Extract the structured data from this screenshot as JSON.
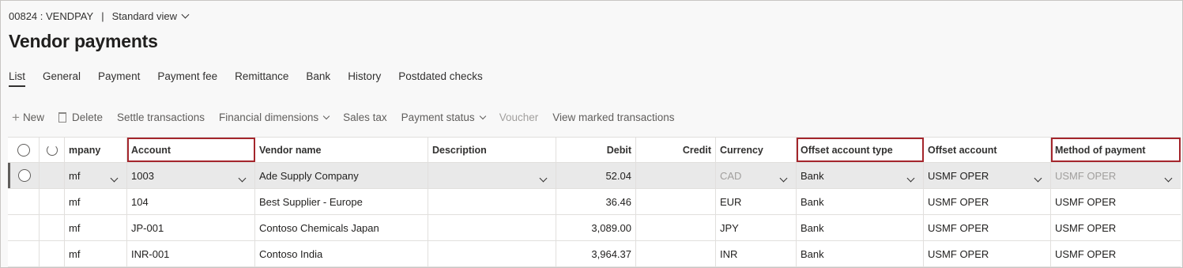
{
  "breadcrumb": {
    "record": "00824 : VENDPAY",
    "separator": "|",
    "view": "Standard view"
  },
  "page_title": "Vendor payments",
  "tabs": [
    "List",
    "General",
    "Payment",
    "Payment fee",
    "Remittance",
    "Bank",
    "History",
    "Postdated checks"
  ],
  "toolbar": {
    "new": "New",
    "delete": "Delete",
    "settle": "Settle transactions",
    "financial_dimensions": "Financial dimensions",
    "sales_tax": "Sales tax",
    "payment_status": "Payment status",
    "voucher": "Voucher",
    "view_marked": "View marked transactions"
  },
  "columns": {
    "company": "mpany",
    "account": "Account",
    "vendor_name": "Vendor name",
    "description": "Description",
    "debit": "Debit",
    "credit": "Credit",
    "currency": "Currency",
    "offset_account_type": "Offset account type",
    "offset_account": "Offset account",
    "method_of_payment": "Method of payment"
  },
  "rows": [
    {
      "company": "mf",
      "account": "1003",
      "vendor_name": "Ade Supply Company",
      "description": "",
      "debit": "52.04",
      "credit": "",
      "currency": "CAD",
      "offset_account_type": "Bank",
      "offset_account": "USMF OPER",
      "method_of_payment": "USMF OPER"
    },
    {
      "company": "mf",
      "account": "104",
      "vendor_name": "Best Supplier - Europe",
      "description": "",
      "debit": "36.46",
      "credit": "",
      "currency": "EUR",
      "offset_account_type": "Bank",
      "offset_account": "USMF OPER",
      "method_of_payment": "USMF OPER"
    },
    {
      "company": "mf",
      "account": "JP-001",
      "vendor_name": "Contoso Chemicals Japan",
      "description": "",
      "debit": "3,089.00",
      "credit": "",
      "currency": "JPY",
      "offset_account_type": "Bank",
      "offset_account": "USMF OPER",
      "method_of_payment": "USMF OPER"
    },
    {
      "company": "mf",
      "account": "INR-001",
      "vendor_name": "Contoso India",
      "description": "",
      "debit": "3,964.37",
      "credit": "",
      "currency": "INR",
      "offset_account_type": "Bank",
      "offset_account": "USMF OPER",
      "method_of_payment": "USMF OPER"
    }
  ],
  "colors": {
    "highlight": "#a4262c",
    "selected_row": "#e9e9e9",
    "border": "#e1dfdd"
  }
}
